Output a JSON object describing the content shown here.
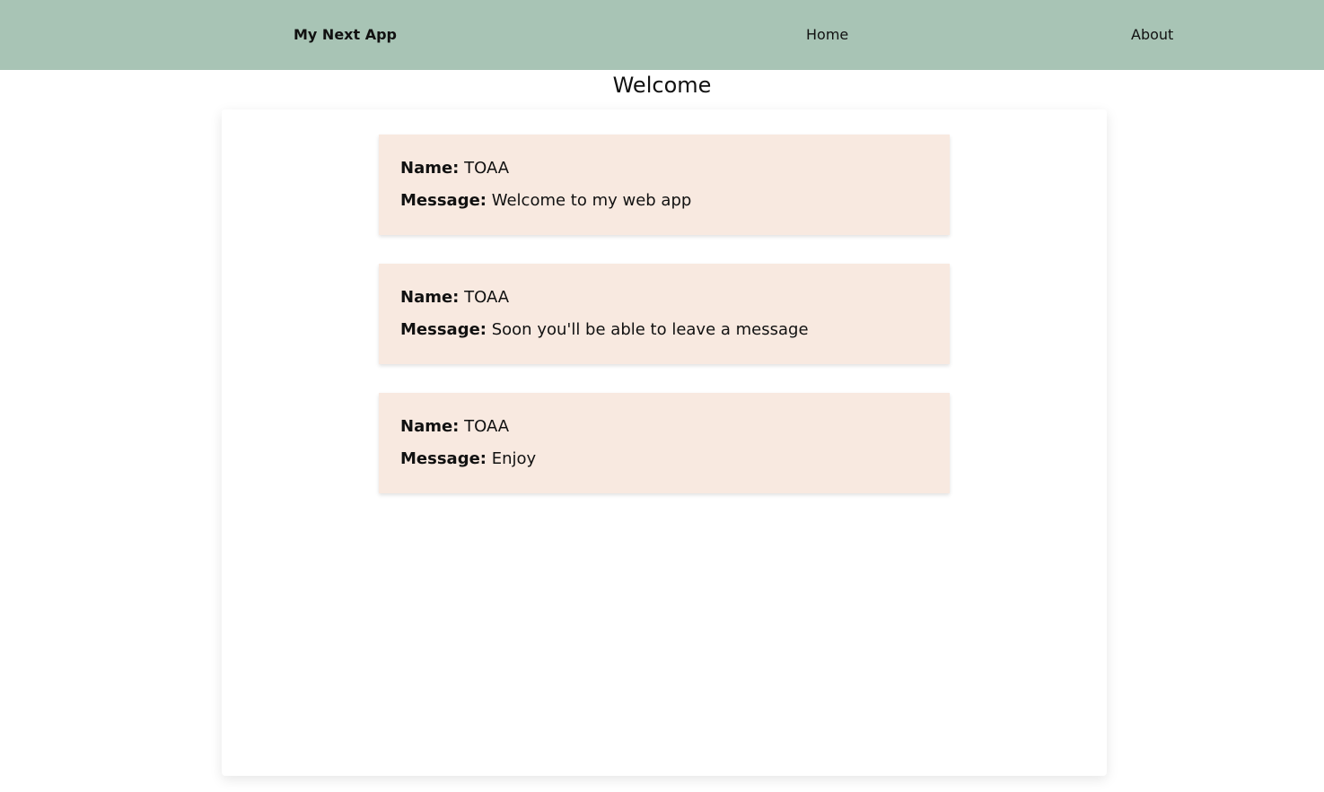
{
  "nav": {
    "brand": "My Next App",
    "links": [
      {
        "label": "Home"
      },
      {
        "label": "About"
      }
    ]
  },
  "page": {
    "title": "Welcome"
  },
  "messages": {
    "name_label": "Name:",
    "message_label": "Message:",
    "items": [
      {
        "name": "TOAA",
        "message": "Welcome to my web app"
      },
      {
        "name": "TOAA",
        "message": "Soon you'll be able to leave a message"
      },
      {
        "name": "TOAA",
        "message": "Enjoy"
      }
    ]
  },
  "colors": {
    "navbar": "#a8c4b5",
    "card": "#f8e9e0",
    "text": "#111111"
  }
}
